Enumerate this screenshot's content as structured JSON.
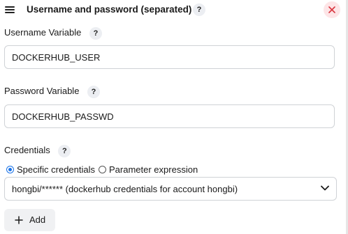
{
  "header": {
    "title": "Username and password (separated)",
    "help_label": "?"
  },
  "username": {
    "label": "Username Variable",
    "help_label": "?",
    "value": "DOCKERHUB_USER"
  },
  "password": {
    "label": "Password Variable",
    "help_label": "?",
    "value": "DOCKERHUB_PASSWD"
  },
  "credentials": {
    "label": "Credentials",
    "help_label": "?",
    "radio_options": [
      {
        "label": "Specific credentials",
        "checked": true
      },
      {
        "label": "Parameter expression",
        "checked": false
      }
    ],
    "selected_value": "hongbi/****** (dockerhub credentials for account hongbi)"
  },
  "add_button": {
    "label": "Add",
    "icon": "plus-icon"
  },
  "icons": {
    "drag": "drag-handle-icon",
    "close": "close-icon",
    "chevron": "chevron-down-icon"
  },
  "colors": {
    "accent": "#1a73e8",
    "close_bg": "#fde5e7",
    "close_fg": "#d9353f",
    "button_bg": "#f0f1f3"
  }
}
